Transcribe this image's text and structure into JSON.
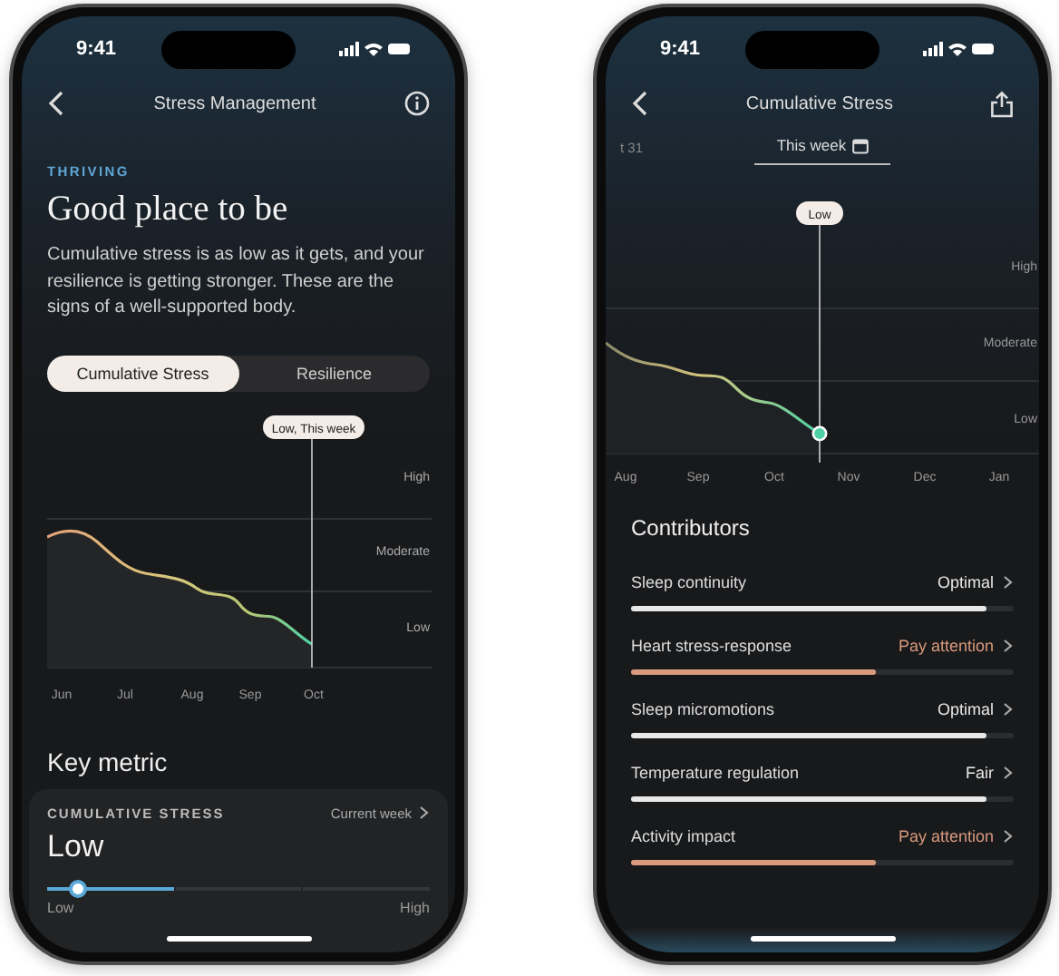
{
  "left_screen": {
    "status_bar": {
      "time": "9:41"
    },
    "nav": {
      "title": "Stress Management"
    },
    "eyebrow": "THRIVING",
    "heading": "Good place to be",
    "description": "Cumulative stress is as low as it gets, and your resilience is getting stronger. These are the signs of a well-supported body.",
    "tabs": [
      {
        "label": "Cumulative Stress",
        "selected": true
      },
      {
        "label": "Resilience",
        "selected": false
      }
    ],
    "chart": {
      "tooltip": "Low, This week",
      "bands": [
        "High",
        "Moderate",
        "Low"
      ],
      "months": [
        "Jun",
        "Jul",
        "Aug",
        "Sep",
        "Oct"
      ]
    },
    "key_metric": {
      "title": "Key metric",
      "label": "CUMULATIVE STRESS",
      "period": "Current week",
      "value": "Low",
      "level": 0.08,
      "min_label": "Low",
      "max_label": "High"
    }
  },
  "right_screen": {
    "status_bar": {
      "time": "9:41"
    },
    "nav": {
      "title": "Cumulative Stress"
    },
    "previous_period": "t 31",
    "period": "This week",
    "chart": {
      "tooltip": "Low",
      "bands": [
        "High",
        "Moderate",
        "Low"
      ],
      "months": [
        "Aug",
        "Sep",
        "Oct",
        "Nov",
        "Dec",
        "Jan"
      ]
    },
    "contributors": {
      "title": "Contributors",
      "items": [
        {
          "name": "Sleep continuity",
          "status": "Optimal",
          "color": "#e8e8e8",
          "level": 0.93
        },
        {
          "name": "Heart stress-response",
          "status": "Pay attention",
          "color": "#d99a7e",
          "level": 0.64
        },
        {
          "name": "Sleep micromotions",
          "status": "Optimal",
          "color": "#e8e8e8",
          "level": 0.93
        },
        {
          "name": "Temperature regulation",
          "status": "Fair",
          "color": "#e8e8e8",
          "level": 0.93
        },
        {
          "name": "Activity impact",
          "status": "Pay attention",
          "color": "#d99a7e",
          "level": 0.64
        }
      ]
    }
  }
}
